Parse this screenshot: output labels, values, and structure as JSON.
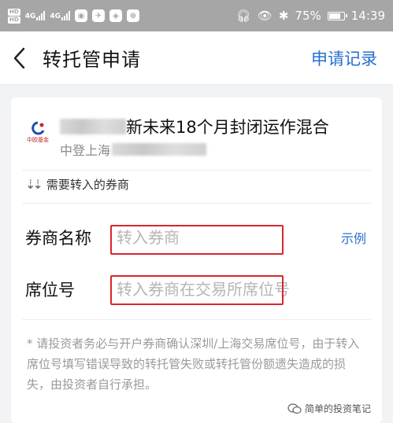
{
  "statusbar": {
    "sim1": "HD",
    "sim2": "HD",
    "net1": "4G",
    "net2": "4G",
    "battery": "75%",
    "time": "14:39"
  },
  "nav": {
    "title": "转托管申请",
    "action": "申请记录"
  },
  "fund": {
    "name": "新未来18个月封闭运作混合",
    "subtitle": "中登上海",
    "logo_text": "中欧基金"
  },
  "section": {
    "title": "需要转入的券商"
  },
  "form": {
    "broker_label": "券商名称",
    "broker_placeholder": "转入券商",
    "example_label": "示例",
    "seat_label": "席位号",
    "seat_placeholder": "转入券商在交易所席位号"
  },
  "notice": "* 请投资者务必与开户券商确认深圳/上海交易席位号，由于转入席位号填写错误导致的转托管失败或转托管份额遗失造成的损失，由投资者自行承担。",
  "watermark": "简单的投资笔记",
  "colors": {
    "accent": "#2a6fcf",
    "highlight": "#d8262c"
  }
}
